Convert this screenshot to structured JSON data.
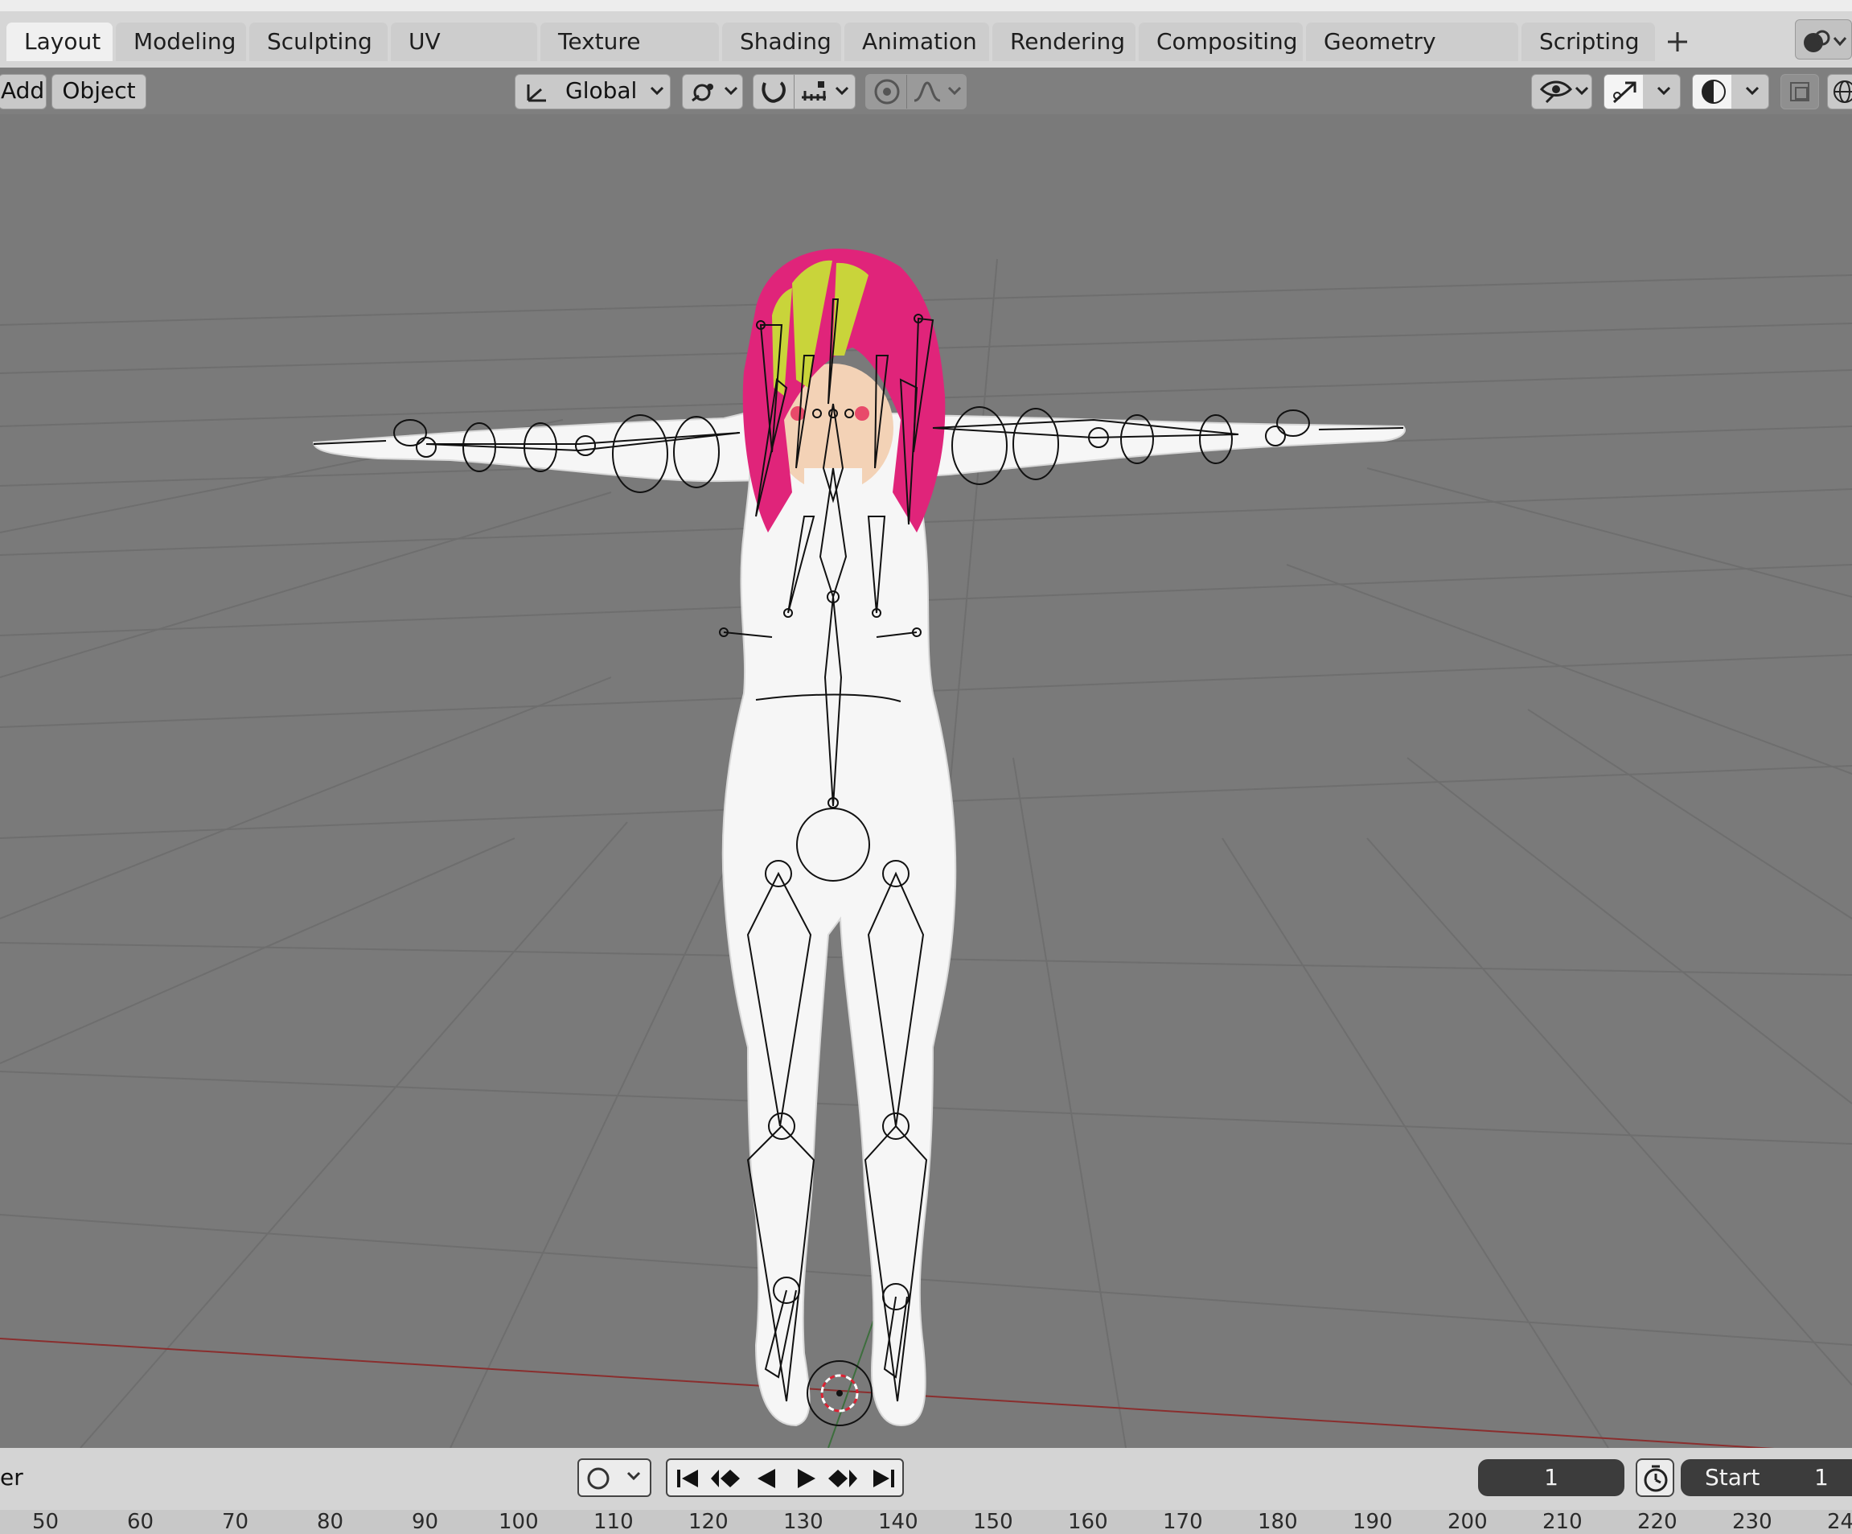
{
  "workspace_tabs": [
    {
      "label": "Layout",
      "active": true
    },
    {
      "label": "Modeling"
    },
    {
      "label": "Sculpting"
    },
    {
      "label": "UV Editing"
    },
    {
      "label": "Texture Paint"
    },
    {
      "label": "Shading"
    },
    {
      "label": "Animation"
    },
    {
      "label": "Rendering"
    },
    {
      "label": "Compositing"
    },
    {
      "label": "Geometry Nodes"
    },
    {
      "label": "Scripting"
    }
  ],
  "add_tab_icon": "plus-icon",
  "header": {
    "add_menu": "Add",
    "object_menu": "Object",
    "transform_orientation": "Global",
    "icons": [
      "orientation-axes-icon",
      "pivot-point-icon",
      "snap-magnet-icon",
      "snap-increment-icon",
      "proportional-edit-icon",
      "falloff-curve-icon",
      "visibility-eye-icon",
      "gizmo-arrow-icon",
      "overlay-sphere-icon",
      "xray-icon",
      "wireframe-globe-icon",
      "engine-icon"
    ]
  },
  "timeline": {
    "left_label": "er",
    "current_frame": "1",
    "start_label": "Start",
    "start_value": "1",
    "ruler": [
      "50",
      "60",
      "70",
      "80",
      "90",
      "100",
      "110",
      "120",
      "130",
      "140",
      "150",
      "160",
      "170",
      "180",
      "190",
      "200",
      "210",
      "220",
      "230",
      "24"
    ]
  },
  "colors": {
    "viewport_bg": "#7a7a7a",
    "grid": "#6d6d6d",
    "x_axis": "#8a2e2e",
    "y_axis": "#3d6e3d",
    "hair": "#e0247a",
    "hair_highlight": "#c9d43a",
    "skin": "#f3d2b6",
    "body": "#f6f6f6"
  }
}
